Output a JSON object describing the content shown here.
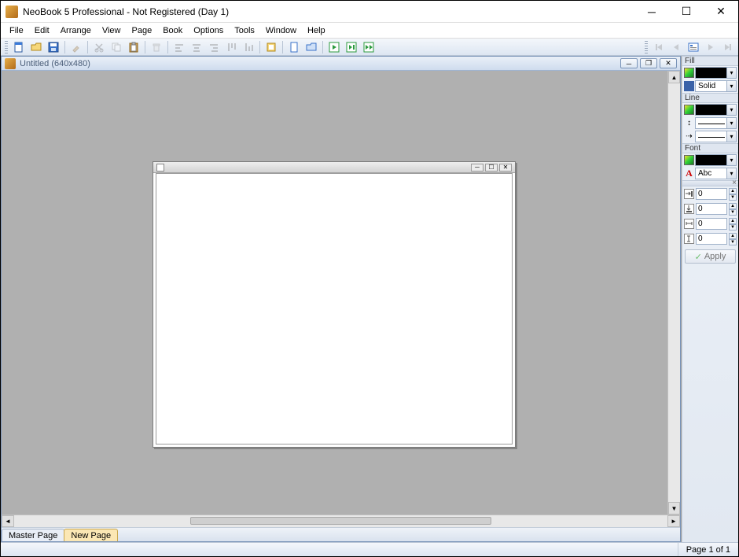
{
  "titlebar": {
    "title": "NeoBook 5 Professional - Not Registered (Day 1)"
  },
  "menu": {
    "items": [
      "File",
      "Edit",
      "Arrange",
      "View",
      "Page",
      "Book",
      "Options",
      "Tools",
      "Window",
      "Help"
    ]
  },
  "document": {
    "title": "Untitled (640x480)"
  },
  "tabs": {
    "master": "Master Page",
    "newpage": "New Page"
  },
  "side": {
    "fill_label": "Fill",
    "fill_style": "Solid",
    "line_label": "Line",
    "font_label": "Font",
    "font_sample": "Abc",
    "pos_x": "0",
    "pos_y": "0",
    "size_w": "0",
    "size_h": "0",
    "apply": "Apply"
  },
  "status": {
    "page": "Page 1 of 1"
  },
  "colors": {
    "accent_bg": "#dde6f2",
    "canvas": "#b0b0b0"
  }
}
